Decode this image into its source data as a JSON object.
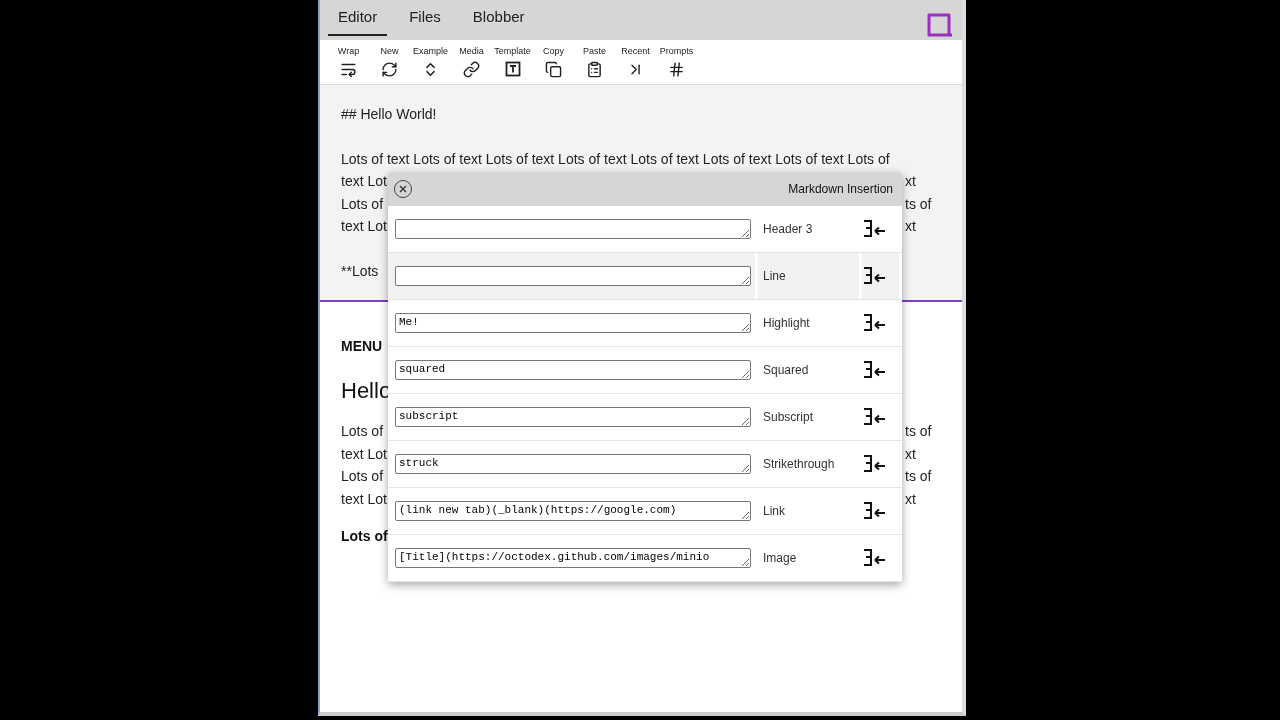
{
  "tabs": [
    {
      "label": "Editor",
      "selected": true
    },
    {
      "label": "Files",
      "selected": false
    },
    {
      "label": "Blobber",
      "selected": false
    }
  ],
  "toolbar": [
    "Wrap",
    "New",
    "Example",
    "Media",
    "Template",
    "Copy",
    "Paste",
    "Recent",
    "Prompts"
  ],
  "editor": {
    "heading": "## Hello World!",
    "lines": [
      {
        "left": "Lots of text Lots of text Lots of text Lots of text Lots of text Lots of text Lots of text Lots of"
      },
      {
        "left": "text Lot",
        "right": "xt"
      },
      {
        "left": "Lots of",
        "right": "ts of"
      },
      {
        "left": "text Lot",
        "right": "xt"
      }
    ],
    "last": "**Lots"
  },
  "preview": {
    "menu": "MENU",
    "heading": "Hello",
    "lines": [
      {
        "left": "Lots of",
        "right": "ts of"
      },
      {
        "left": "text Lot",
        "right": "xt"
      },
      {
        "left": "Lots of",
        "right": "ts of"
      },
      {
        "left": "text Lot",
        "right": "xt"
      }
    ],
    "last": "Lots of"
  },
  "dialog": {
    "title": "Markdown Insertion",
    "rows": [
      {
        "label": "Header 3",
        "highlighted": false
      },
      {
        "label": "Line",
        "highlighted": true
      },
      {
        "label": "Highlight",
        "value": "Me!",
        "highlighted": false
      },
      {
        "label": "Squared",
        "value": "squared",
        "highlighted": false
      },
      {
        "label": "Subscript",
        "value": "subscript",
        "highlighted": false
      },
      {
        "label": "Strikethrough",
        "value": "struck",
        "highlighted": false
      },
      {
        "label": "Link",
        "value": "(link new tab)(_blank)(https://google.com)",
        "highlighted": false
      },
      {
        "label": "Image",
        "value": "[Title](https://octodex.github.com/images/minio",
        "highlighted": false
      }
    ]
  }
}
